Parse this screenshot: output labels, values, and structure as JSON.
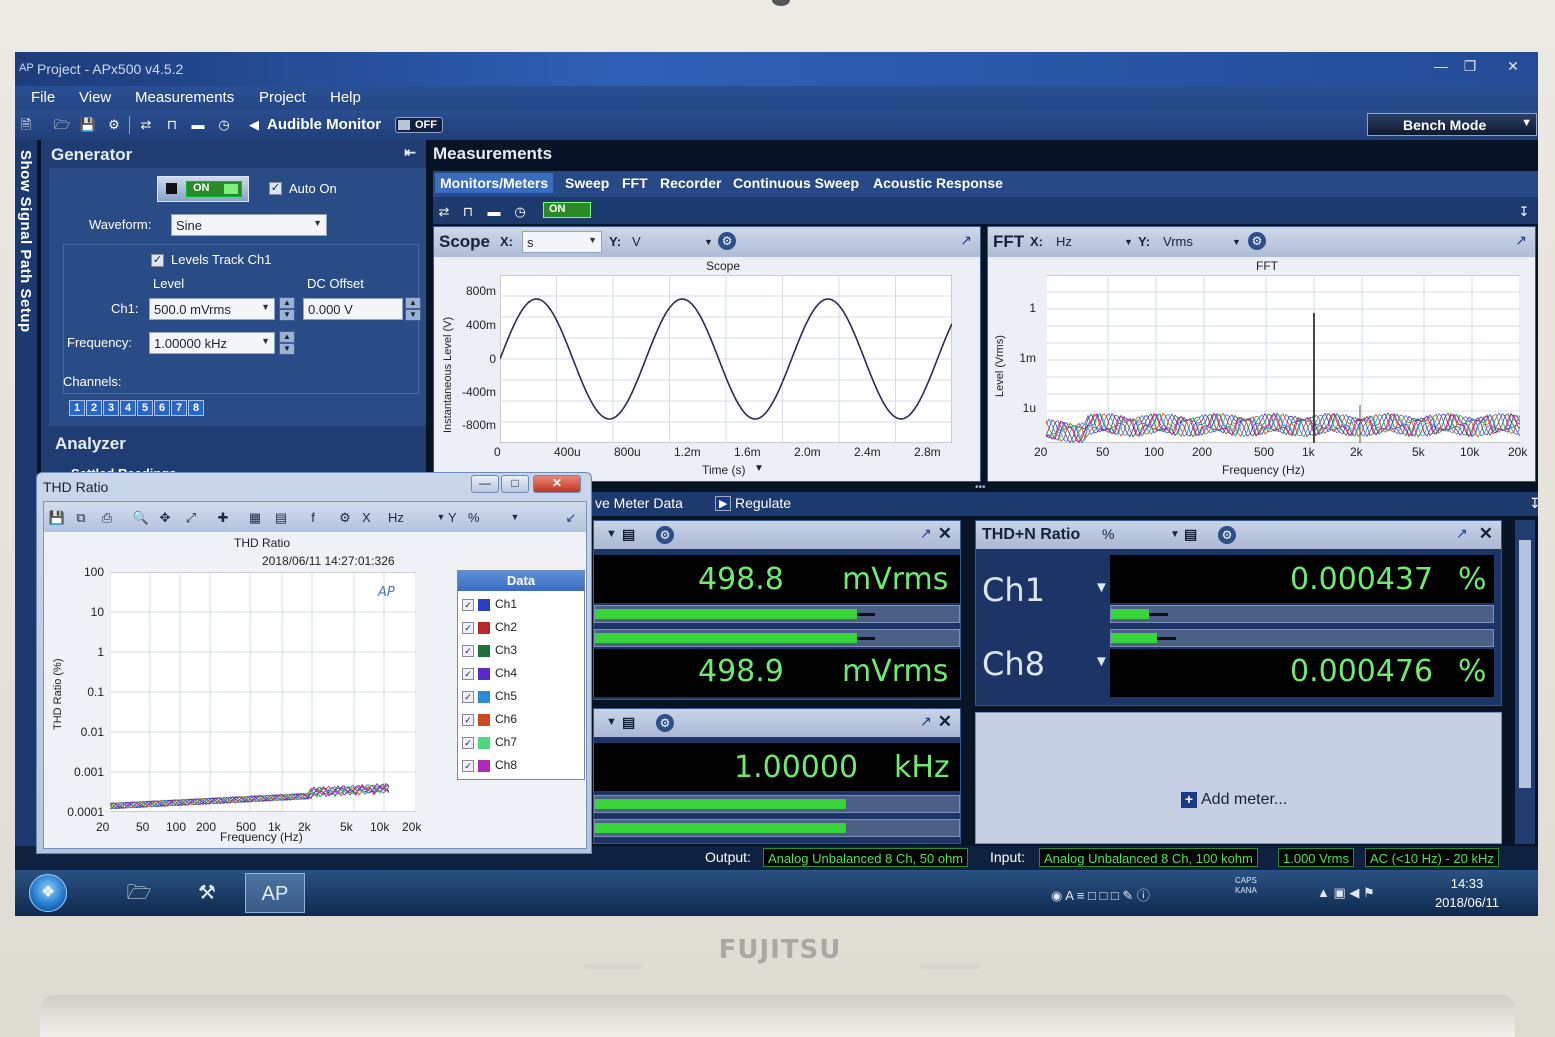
{
  "window": {
    "title": "Project - APx500 v4.5.2"
  },
  "menu": [
    "File",
    "View",
    "Measurements",
    "Project",
    "Help"
  ],
  "toolbar": {
    "audible_monitor": "Audible Monitor",
    "audible_state": "OFF",
    "mode": "Bench Mode"
  },
  "sidebar": {
    "vertical_label": "Show Signal Path Setup"
  },
  "generator": {
    "title": "Generator",
    "on_label": "ON",
    "auto_on": "Auto On",
    "waveform_label": "Waveform:",
    "waveform": "Sine",
    "levels_track": "Levels Track Ch1",
    "level_header": "Level",
    "dc_header": "DC Offset",
    "ch1_label": "Ch1:",
    "ch1_level": "500.0 mVrms",
    "dc_offset": "0.000 V",
    "freq_label": "Frequency:",
    "frequency": "1.00000 kHz",
    "channels_label": "Channels:",
    "channels": [
      "1",
      "2",
      "3",
      "4",
      "5",
      "6",
      "7",
      "8"
    ]
  },
  "analyzer": {
    "title": "Analyzer",
    "settled": "Settled Readings"
  },
  "measurements": {
    "title": "Measurements",
    "tabs": [
      "Monitors/Meters",
      "Sweep",
      "FFT",
      "Recorder",
      "Continuous Sweep",
      "Acoustic Response"
    ],
    "on_label": "ON"
  },
  "scope": {
    "title": "Scope",
    "x_label": "X:",
    "x_unit": "s",
    "y_label": "Y:",
    "y_unit": "V",
    "chart_title": "Scope",
    "xlabel": "Time (s)",
    "ylabel": "Instantaneous Level (V)",
    "xticks": [
      "0",
      "400u",
      "800u",
      "1.2m",
      "1.6m",
      "2.0m",
      "2.4m",
      "2.8m"
    ],
    "yticks": [
      "800m",
      "400m",
      "0",
      "-400m",
      "-800m"
    ]
  },
  "fft": {
    "title": "FFT",
    "x_label": "X:",
    "x_unit": "Hz",
    "y_label": "Y:",
    "y_unit": "Vrms",
    "chart_title": "FFT",
    "xlabel": "Frequency (Hz)",
    "ylabel": "Level (Vrms)",
    "xticks": [
      "20",
      "50",
      "100",
      "200",
      "500",
      "1k",
      "2k",
      "5k",
      "10k",
      "20k"
    ],
    "yticks": [
      "1",
      "1m",
      "1u"
    ]
  },
  "meters": {
    "strip_label": "ve Meter Data",
    "regulate": "Regulate",
    "level_ch1": "498.8",
    "level_ch8": "498.9",
    "level_unit": "mVrms",
    "level_fill_ch1": 0.72,
    "level_fill_ch8": 0.72,
    "freq_value": "1.00000",
    "freq_unit": "kHz",
    "freq_fill": 0.69,
    "thdn": {
      "title": "THD+N Ratio",
      "unit_select": "%",
      "ch1_label": "Ch1",
      "ch8_label": "Ch8",
      "ch1_value": "0.000437",
      "ch8_value": "0.000476",
      "unit": "%",
      "fill_ch1": 0.1,
      "fill_ch8": 0.12
    },
    "add_meter": "Add meter..."
  },
  "status": {
    "output_label": "Output:",
    "output": "Analog Unbalanced 8 Ch, 50 ohm",
    "input_label": "Input:",
    "input": "Analog Unbalanced 8 Ch, 100 kohm",
    "range": "1.000 Vrms",
    "bandwidth": "AC (<10 Hz) - 20 kHz"
  },
  "taskbar": {
    "time": "14:33",
    "date": "2018/06/11",
    "caps": "CAPS",
    "kana": "KANA"
  },
  "thd_window": {
    "title": "THD Ratio",
    "x_label": "X",
    "x_unit": "Hz",
    "y_label": "Y",
    "y_unit": "%",
    "chart_title": "THD Ratio",
    "timestamp": "2018/06/11 14:27:01:326",
    "xlabel": "Frequency (Hz)",
    "ylabel": "THD Ratio (%)",
    "xticks": [
      "20",
      "50",
      "100",
      "200",
      "500",
      "1k",
      "2k",
      "5k",
      "10k",
      "20k"
    ],
    "yticks": [
      "100",
      "10",
      "1",
      "0.1",
      "0.01",
      "0.001",
      "0.0001"
    ],
    "legend_title": "Data",
    "channels": [
      {
        "name": "Ch1",
        "color": "#2a3fc8"
      },
      {
        "name": "Ch2",
        "color": "#b82a2a"
      },
      {
        "name": "Ch3",
        "color": "#1e6e3e"
      },
      {
        "name": "Ch4",
        "color": "#5a2ac8"
      },
      {
        "name": "Ch5",
        "color": "#2a8ad8"
      },
      {
        "name": "Ch6",
        "color": "#c84a1e"
      },
      {
        "name": "Ch7",
        "color": "#4ad87a"
      },
      {
        "name": "Ch8",
        "color": "#b02ab8"
      }
    ]
  }
}
